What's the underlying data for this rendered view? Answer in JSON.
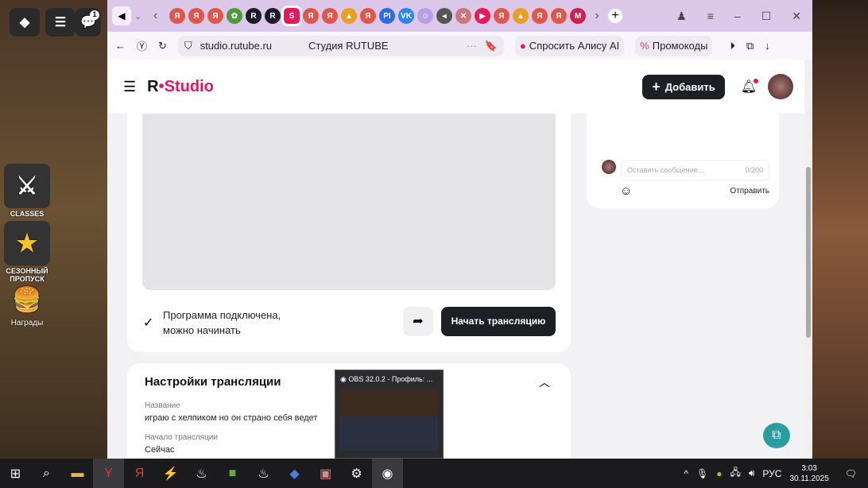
{
  "desktop": {
    "classes": "CLASSES",
    "season_pass": "СЕЗОННЫЙ ПРОПУСК",
    "rewards": "Награды",
    "notif_count": "1"
  },
  "browser": {
    "url": "studio.rutube.ru",
    "page_title": "Студия RUTUBE",
    "alice": "Спросить Алису AI",
    "promo": "Промокоды",
    "tabs": [
      {
        "t": "Я",
        "c": "#e0574a"
      },
      {
        "t": "Я",
        "c": "#e0574a"
      },
      {
        "t": "Я",
        "c": "#e0574a"
      },
      {
        "t": "✿",
        "c": "#4a9a3a"
      },
      {
        "t": "R",
        "c": "#1b1b2b"
      },
      {
        "t": "R",
        "c": "#1b1b2b"
      },
      {
        "t": "S",
        "c": "#e5195a"
      },
      {
        "t": "Я",
        "c": "#e0574a"
      },
      {
        "t": "Я",
        "c": "#e0574a"
      },
      {
        "t": "▲",
        "c": "#e8a020"
      },
      {
        "t": "Я",
        "c": "#e0574a"
      },
      {
        "t": "PI",
        "c": "#2a6fe0"
      },
      {
        "t": "VK",
        "c": "#2787f5"
      },
      {
        "t": "☺",
        "c": "#b8a0e0"
      },
      {
        "t": "◂",
        "c": "#555"
      },
      {
        "t": "✕",
        "c": "#c77"
      },
      {
        "t": "▶",
        "c": "#e5195a"
      },
      {
        "t": "Я",
        "c": "#e0574a"
      },
      {
        "t": "▲",
        "c": "#e8a020"
      },
      {
        "t": "Я",
        "c": "#e0574a"
      },
      {
        "t": "Я",
        "c": "#e0574a"
      },
      {
        "t": "M",
        "c": "#d02050"
      }
    ]
  },
  "header": {
    "logo_r": "R",
    "logo_text": "Studio",
    "add_label": "Добавить"
  },
  "stream": {
    "status": "Программа подключена,",
    "status2": "можно начинать",
    "start_label": "Начать трансляцию"
  },
  "chat": {
    "placeholder": "Оставить сообщение...",
    "counter": "0/200",
    "send": "Отправить"
  },
  "settings": {
    "title": "Настройки трансляции",
    "name_label": "Название",
    "name_value": "играю с хелпиком но он страно себя ведет",
    "start_label": "Начало трансляции",
    "start_value": "Сейчас"
  },
  "obs_popup": {
    "title": "OBS 32.0.2 - Профиль: ..."
  },
  "taskbar": {
    "lang": "РУС",
    "time": "3:03",
    "date": "30.11.2025"
  }
}
